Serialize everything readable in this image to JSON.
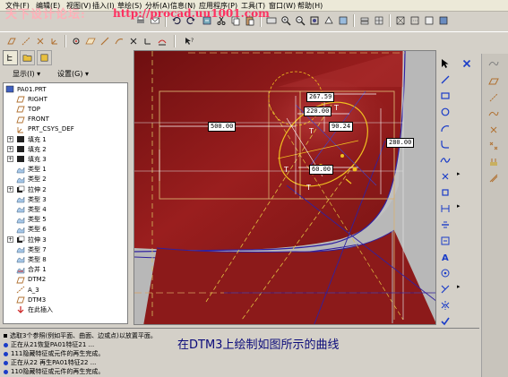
{
  "menubar": {
    "items": [
      "文件(F)",
      "编辑(E)",
      "视图(V)",
      "插入(I)",
      "草绘(S)",
      "分析(A)",
      "信息(N)",
      "应用程序(P)",
      "工具(T)",
      "窗口(W)",
      "帮助(H)"
    ]
  },
  "watermark": {
    "title": "天下设计论坛:",
    "url": "http://procad.uu1001.com"
  },
  "panel": {
    "display_label": "显示(I) ▾",
    "settings_label": "设置(G) ▾"
  },
  "tree": {
    "items": [
      {
        "label": "PA01.PRT",
        "icon": "part-icon",
        "expand": false,
        "indent": 0
      },
      {
        "label": "RIGHT",
        "icon": "datum-plane-icon",
        "expand": false,
        "indent": 1
      },
      {
        "label": "TOP",
        "icon": "datum-plane-icon",
        "expand": false,
        "indent": 1
      },
      {
        "label": "FRONT",
        "icon": "datum-plane-icon",
        "expand": false,
        "indent": 1
      },
      {
        "label": "PRT_CSYS_DEF",
        "icon": "csys-icon",
        "expand": false,
        "indent": 1
      },
      {
        "label": "填充 1",
        "icon": "fill-icon",
        "expand": true,
        "indent": 1
      },
      {
        "label": "填充 2",
        "icon": "fill-icon",
        "expand": true,
        "indent": 1
      },
      {
        "label": "填充 3",
        "icon": "fill-icon",
        "expand": true,
        "indent": 1
      },
      {
        "label": "类型 1",
        "icon": "surface-icon",
        "expand": false,
        "indent": 1
      },
      {
        "label": "类型 2",
        "icon": "surface-icon",
        "expand": false,
        "indent": 1
      },
      {
        "label": "拉伸 2",
        "icon": "extrude-icon",
        "expand": true,
        "indent": 1
      },
      {
        "label": "类型 3",
        "icon": "surface-icon",
        "expand": false,
        "indent": 1
      },
      {
        "label": "类型 4",
        "icon": "surface-icon",
        "expand": false,
        "indent": 1
      },
      {
        "label": "类型 5",
        "icon": "surface-icon",
        "expand": false,
        "indent": 1
      },
      {
        "label": "类型 6",
        "icon": "surface-icon",
        "expand": false,
        "indent": 1
      },
      {
        "label": "拉伸 3",
        "icon": "extrude-icon",
        "expand": true,
        "indent": 1
      },
      {
        "label": "类型 7",
        "icon": "surface-icon",
        "expand": false,
        "indent": 1
      },
      {
        "label": "类型 8",
        "icon": "surface-icon",
        "expand": false,
        "indent": 1
      },
      {
        "label": "合并 1",
        "icon": "merge-icon",
        "expand": false,
        "indent": 1
      },
      {
        "label": "DTM2",
        "icon": "datum-plane-icon",
        "expand": false,
        "indent": 1
      },
      {
        "label": "A_3",
        "icon": "datum-axis-icon",
        "expand": false,
        "indent": 1
      },
      {
        "label": "DTM3",
        "icon": "datum-plane-icon",
        "expand": false,
        "indent": 1
      },
      {
        "label": "在此插入",
        "icon": "insert-arrow-icon",
        "expand": false,
        "indent": 1
      }
    ]
  },
  "dimensions": {
    "d1": "267.59",
    "d2": "220.00",
    "d3": "500.00",
    "d4": "90.24",
    "d5": "60.00",
    "d6": "280.00"
  },
  "messages": [
    "选取3个参照(例如平面、曲面、边或点)以放置平面。",
    "正在从21恢复PA01特征21 ...",
    "111隐藏特征或元件的再生完成。",
    "正在从22 再生PA01特征22 ...",
    "110隐藏特征或元件的再生完成。"
  ],
  "caption": "在DTM3上绘制如图所示的曲线",
  "colors": {
    "model_red": "#8c1a1a",
    "sketch_yellow": "#f0c020",
    "accent_blue": "#1a3cc8",
    "datum_brown": "#b07030"
  }
}
